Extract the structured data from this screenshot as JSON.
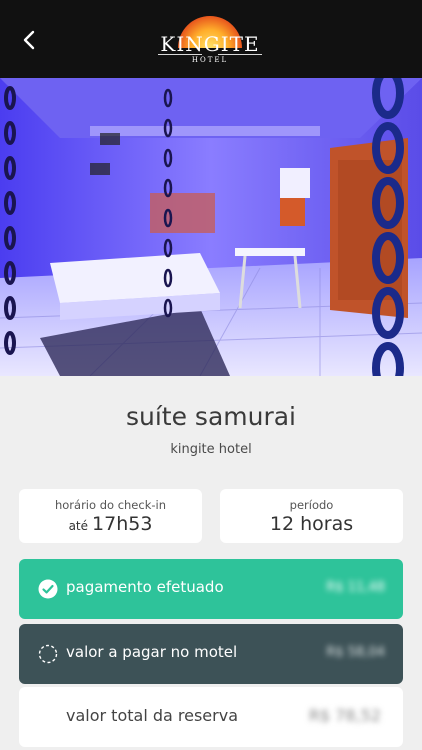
{
  "header": {
    "brand": "KINGITE",
    "brand_sub": "HOTEL",
    "back_icon": "chevron-left-icon"
  },
  "room": {
    "name": "suíte samurai",
    "hotel": "kingite hotel"
  },
  "checkin": {
    "label": "horário do check-in",
    "prefix": "até",
    "time": "17h53"
  },
  "period": {
    "label": "período",
    "value": "12 horas"
  },
  "payments": {
    "paid_label": "pagamento efetuado",
    "paid_amount": "R$ 11,48",
    "paid_color": "#2ec39a",
    "due_label": "valor a pagar no motel",
    "due_amount": "R$ 58,04",
    "due_color": "#3d5257",
    "total_label": "valor total da reserva",
    "total_amount": "R$ 78,52"
  }
}
